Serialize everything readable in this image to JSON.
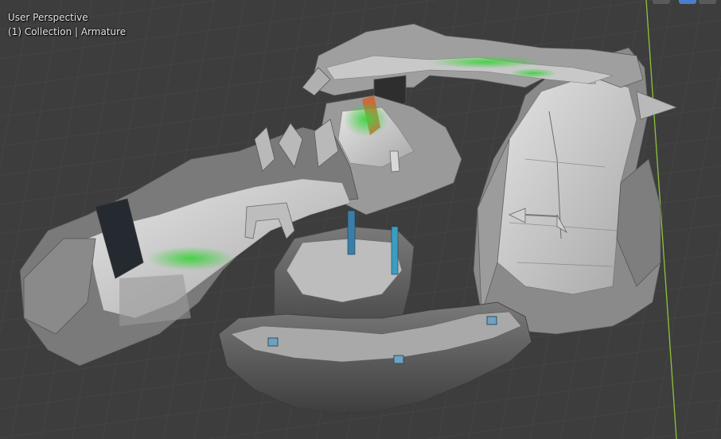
{
  "viewport": {
    "view_name": "User Perspective",
    "collection_info": "(1) Collection | Armature"
  },
  "colors": {
    "background": "#3d3d3d",
    "grid": "#494949",
    "y_axis": "#8ac43a",
    "highlight_green": "#3fd23f",
    "highlight_orange": "#d4622a",
    "banner_blue": "#3a7ea8",
    "gizmo_active": "#4a7ec9"
  },
  "icons": {
    "view_gizmo_buttons": [
      "camera-toggle-icon",
      "perspective-toggle-icon",
      "hand-pan-icon"
    ]
  }
}
